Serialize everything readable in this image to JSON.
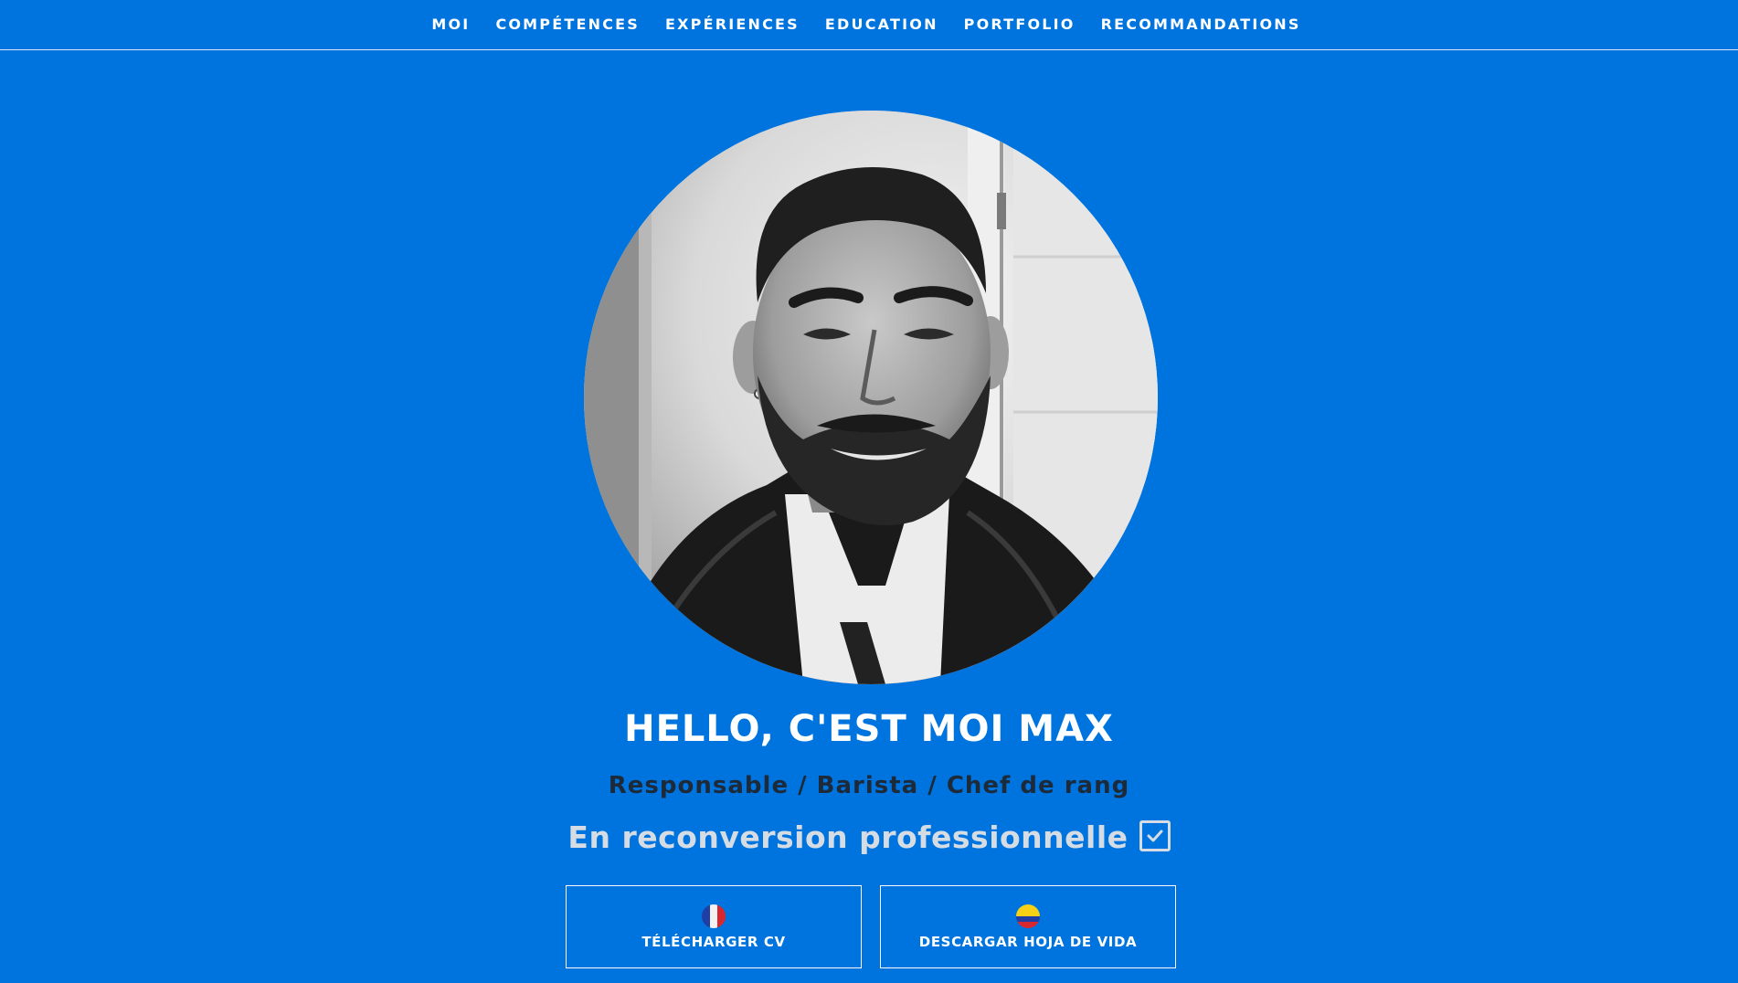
{
  "nav": {
    "items": [
      {
        "label": "MOI"
      },
      {
        "label": "COMPÉTENCES"
      },
      {
        "label": "EXPÉRIENCES"
      },
      {
        "label": "EDUCATION"
      },
      {
        "label": "PORTFOLIO"
      },
      {
        "label": "RECOMMANDATIONS"
      }
    ]
  },
  "hero": {
    "headline": "HELLO, C'EST MOI MAX",
    "subtitle": "Responsable / Barista / Chef de rang",
    "tagline": "En reconversion professionnelle",
    "tagline_icon": "check-square-icon"
  },
  "buttons": {
    "cv_fr": {
      "label": "TÉLÉCHARGER CV",
      "flag": "france-flag-icon"
    },
    "cv_es": {
      "label": "DESCARGAR HOJA DE VIDA",
      "flag": "colombia-flag-icon"
    }
  },
  "colors": {
    "background": "#0074de",
    "text": "#ffffff",
    "subtitle": "#1c2a3a",
    "tagline": "#d6dce4"
  }
}
